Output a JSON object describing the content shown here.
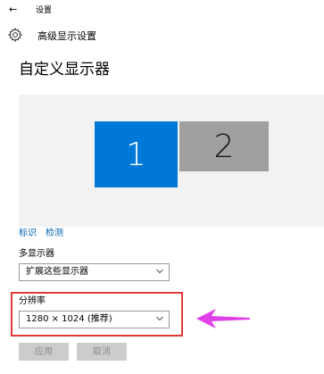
{
  "titlebar": {
    "back_glyph": "←",
    "title": "设置"
  },
  "header": {
    "icon": "gear-icon",
    "title": "高级显示设置"
  },
  "page": {
    "heading": "自定义显示器"
  },
  "displays": [
    {
      "label": "1",
      "state": "selected",
      "color": "#0078d7"
    },
    {
      "label": "2",
      "state": "unselected",
      "color": "#a0a0a0"
    }
  ],
  "links": {
    "identify": "标识",
    "detect": "检测"
  },
  "multiple_displays": {
    "label": "多显示器",
    "value": "扩展这些显示器"
  },
  "resolution": {
    "label": "分辨率",
    "value": "1280 × 1024 (推荐)"
  },
  "buttons": {
    "apply": "应用",
    "cancel": "取消"
  },
  "colors": {
    "accent": "#0078d7",
    "link": "#0063b1",
    "highlight_border": "#e0393a",
    "annotation_arrow": "#e040e8"
  }
}
